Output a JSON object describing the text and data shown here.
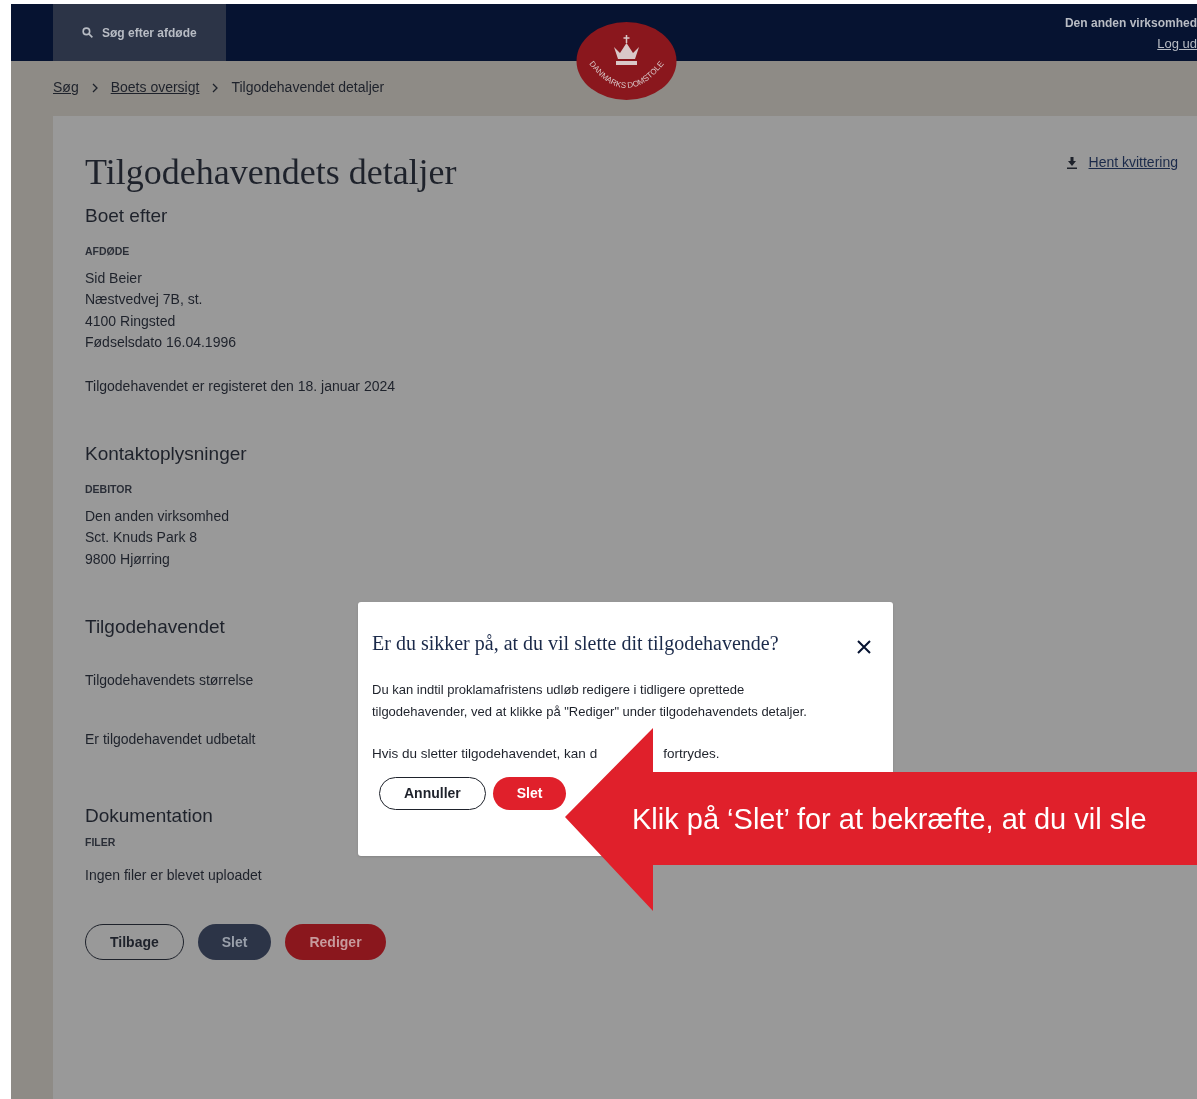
{
  "header": {
    "search_tab": {
      "label": "Søg efter afdøde"
    },
    "logo_text": "DANMARKS DOMSTOLE",
    "user": "Den anden virksomhed",
    "logout": "Log ud"
  },
  "breadcrumb": [
    {
      "label": "Søg",
      "link": true
    },
    {
      "label": "Boets oversigt",
      "link": true
    },
    {
      "label": "Tilgodehavendet detaljer",
      "link": false
    }
  ],
  "download_link": "Hent kvittering",
  "title": "Tilgodehavendets detaljer",
  "sections": [
    {
      "heading": "Boet efter",
      "label": "AFDØDE",
      "lines": [
        "Sid Beier",
        "Næstvedvej 7B, st.",
        "4100 Ringsted",
        "Fødselsdato 16.04.1996"
      ],
      "note": "Tilgodehavendet er registeret den 18. januar 2024"
    },
    {
      "heading": "Kontaktoplysninger",
      "label": "DEBITOR",
      "lines": [
        "Den anden virksomhed",
        "Sct. Knuds Park 8",
        "9800 Hjørring"
      ]
    },
    {
      "heading": "Tilgodehavendet",
      "fields": [
        "Tilgodehavendets størrelse",
        "Er tilgodehavendet udbetalt"
      ]
    },
    {
      "heading": "Dokumentation",
      "label": "FILER",
      "lines": [
        "Ingen filer er blevet uploadet"
      ]
    }
  ],
  "actions": [
    {
      "label": "Tilbage",
      "kind": "outline"
    },
    {
      "label": "Slet",
      "kind": "navy"
    },
    {
      "label": "Rediger",
      "kind": "red"
    }
  ],
  "dialog": {
    "title": "Er du sikker på, at du vil slette dit tilgodehavende?",
    "body": "Du kan indtil proklamafristens udløb redigere i tidligere oprettede tilgodehavender, ved at klikke på \"Rediger\" under tilgodehavendets detaljer.",
    "warning_parts": [
      "Hvis du sletter tilgodehavendet, kan d",
      "fortrydes."
    ],
    "buttons": [
      {
        "label": "Annuller",
        "kind": "outline"
      },
      {
        "label": "Slet",
        "kind": "red"
      }
    ]
  },
  "callout": "Klik på ‘Slet’ for at bekræfte, at du vil sle"
}
